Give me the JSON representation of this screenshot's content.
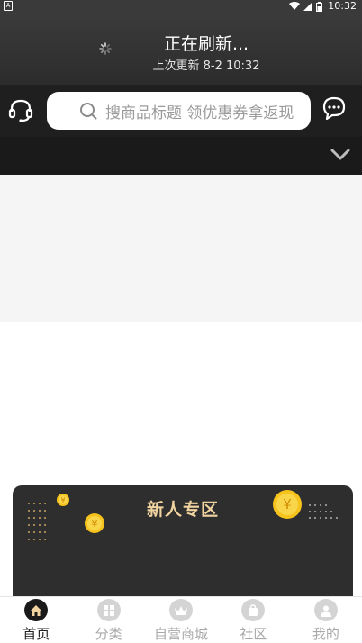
{
  "status_bar": {
    "time": "10:32",
    "icons": [
      "notification-icon",
      "wifi-icon",
      "signal-icon",
      "battery-icon"
    ]
  },
  "refresh": {
    "title": "正在刷新...",
    "last_updated": "上次更新 8-2 10:32"
  },
  "search": {
    "placeholder": "搜商品标题 领优惠券拿返现"
  },
  "icons": {
    "service": "headset-icon",
    "message": "chat-bubble-icon",
    "expand": "chevron-down-icon"
  },
  "new_user_zone": {
    "title": "新人专区"
  },
  "colors": {
    "header_bg": "#333333",
    "accent_gold": "#f1d3a0",
    "coin_yellow": "#f6c21c"
  },
  "tab_bar": {
    "tabs": [
      {
        "label": "首页",
        "icon": "home-icon",
        "active": true
      },
      {
        "label": "分类",
        "icon": "grid-icon",
        "active": false
      },
      {
        "label": "自营商城",
        "icon": "crown-icon",
        "active": false
      },
      {
        "label": "社区",
        "icon": "community-bag-icon",
        "active": false
      },
      {
        "label": "我的",
        "icon": "user-icon",
        "active": false
      }
    ]
  }
}
